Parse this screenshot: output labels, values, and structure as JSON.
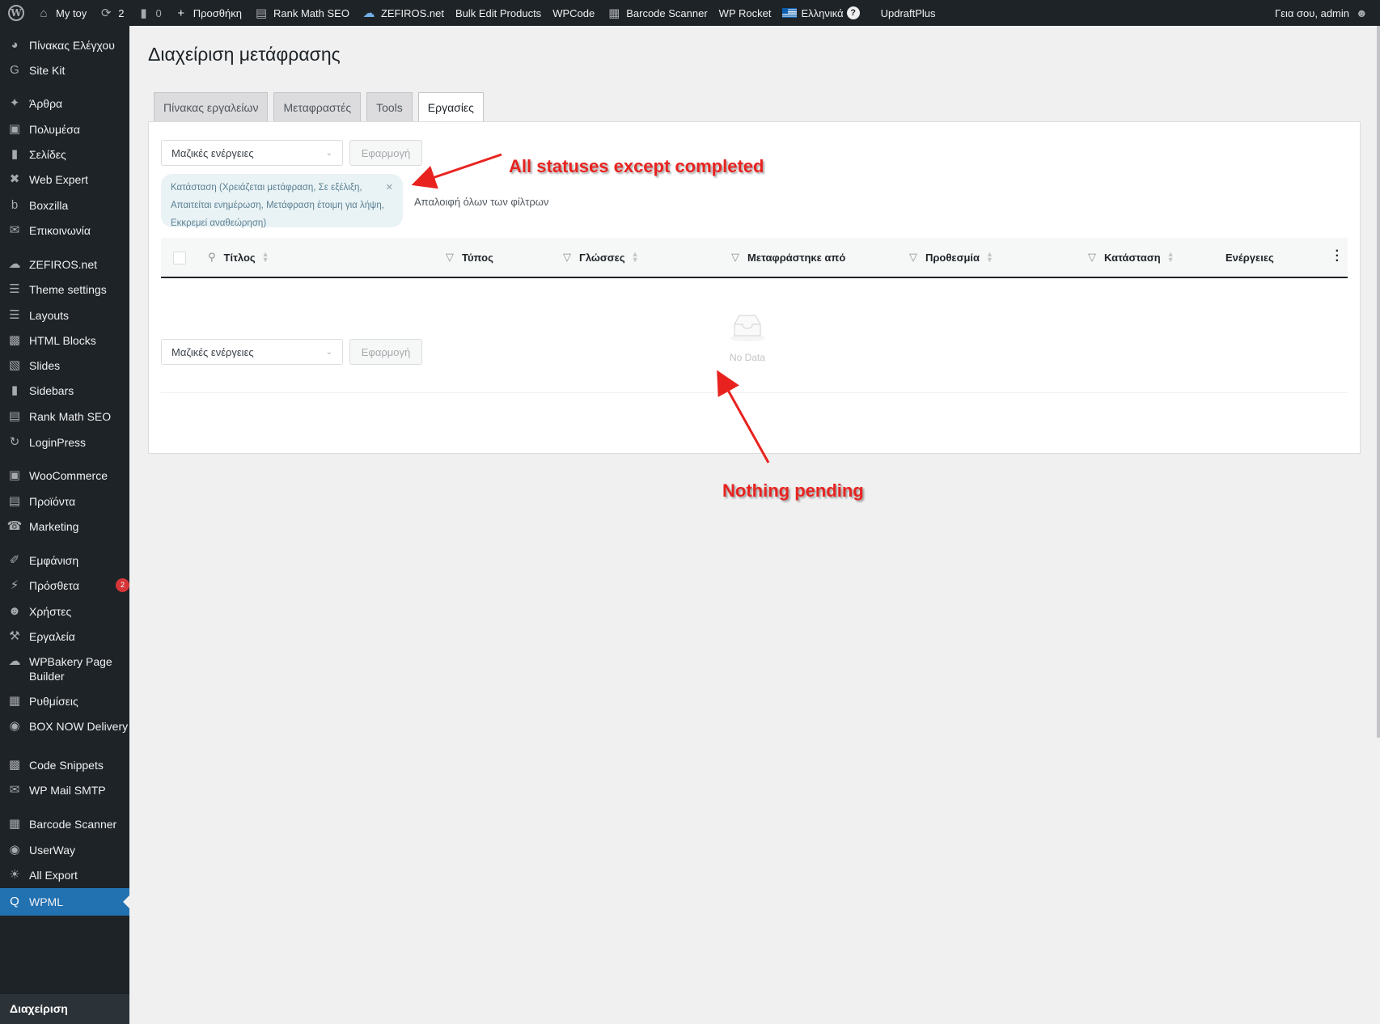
{
  "adminbar": {
    "site_name": "My toy",
    "updates_count": "2",
    "comments_count": "0",
    "items": [
      "Προσθήκη",
      "Rank Math SEO",
      "ZEFIROS.net",
      "Bulk Edit Products",
      "WPCode",
      "Barcode Scanner",
      "WP Rocket",
      "Ελληνικά",
      "UpdraftPlus"
    ],
    "greeting": "Γεια σου, admin"
  },
  "sidebar": {
    "items": [
      {
        "label": "Πίνακας Ελέγχου",
        "icon": "dashboard-icon"
      },
      {
        "label": "Site Kit",
        "icon": "google-icon"
      },
      {
        "label": "Άρθρα",
        "icon": "pin-icon"
      },
      {
        "label": "Πολυμέσα",
        "icon": "media-icon"
      },
      {
        "label": "Σελίδες",
        "icon": "page-icon"
      },
      {
        "label": "Web Expert",
        "icon": "x-mark-icon"
      },
      {
        "label": "Boxzilla",
        "icon": "b-icon"
      },
      {
        "label": "Επικοινωνία",
        "icon": "mail-icon"
      },
      {
        "label": "ZEFIROS.net",
        "icon": "cloud-icon"
      },
      {
        "label": "Theme settings",
        "icon": "sliders-icon"
      },
      {
        "label": "Layouts",
        "icon": "layers-icon"
      },
      {
        "label": "HTML Blocks",
        "icon": "code-icon"
      },
      {
        "label": "Slides",
        "icon": "slides-icon"
      },
      {
        "label": "Sidebars",
        "icon": "sidebar-icon"
      },
      {
        "label": "Rank Math SEO",
        "icon": "chart-icon"
      },
      {
        "label": "LoginPress",
        "icon": "loginpress-icon"
      },
      {
        "label": "WooCommerce",
        "icon": "woo-icon"
      },
      {
        "label": "Προϊόντα",
        "icon": "archive-icon"
      },
      {
        "label": "Marketing",
        "icon": "megaphone-icon"
      },
      {
        "label": "Εμφάνιση",
        "icon": "brush-icon"
      },
      {
        "label": "Πρόσθετα",
        "icon": "plugin-icon",
        "badge": "2"
      },
      {
        "label": "Χρήστες",
        "icon": "user-icon"
      },
      {
        "label": "Εργαλεία",
        "icon": "wrench-icon"
      },
      {
        "label": "WPBakery Page Builder",
        "icon": "cloud-bubble-icon"
      },
      {
        "label": "Ρυθμίσεις",
        "icon": "settings-icon"
      },
      {
        "label": "BOX NOW Delivery",
        "icon": "location-icon"
      },
      {
        "label": "Code Snippets",
        "icon": "snippet-icon"
      },
      {
        "label": "WP Mail SMTP",
        "icon": "envelope-gear-icon"
      },
      {
        "label": "Barcode Scanner",
        "icon": "barcode-icon"
      },
      {
        "label": "UserWay",
        "icon": "accessibility-icon"
      },
      {
        "label": "All Export",
        "icon": "export-icon"
      },
      {
        "label": "WPML",
        "icon": "wpml-icon"
      }
    ],
    "submenu_current": "Διαχείριση"
  },
  "main": {
    "title": "Διαχείριση μετάφρασης",
    "tabs": [
      "Πίνακας εργαλείων",
      "Μεταφραστές",
      "Tools",
      "Εργασίες"
    ],
    "bulk_actions": "Μαζικές ενέργειες",
    "apply": "Εφαρμογή",
    "filter_chip": "Κατάσταση (Χρειάζεται μετάφραση, Σε εξέλιξη, Απαιτείται ενημέρωση, Μετάφραση έτοιμη για λήψη, Εκκρεμεί αναθεώρηση)",
    "clear_filters": "Απαλοιφή όλων των φίλτρων",
    "columns": {
      "title": "Τίτλος",
      "type": "Τύπος",
      "languages": "Γλώσσες",
      "translated_by": "Μεταφράστηκε από",
      "deadline": "Προθεσμία",
      "status": "Κατάσταση",
      "actions": "Ενέργειες"
    },
    "no_data": "No Data"
  },
  "annotations": {
    "statuses": "All statuses except completed",
    "nothing_pending": "Nothing pending",
    "color": "#e8231f"
  }
}
